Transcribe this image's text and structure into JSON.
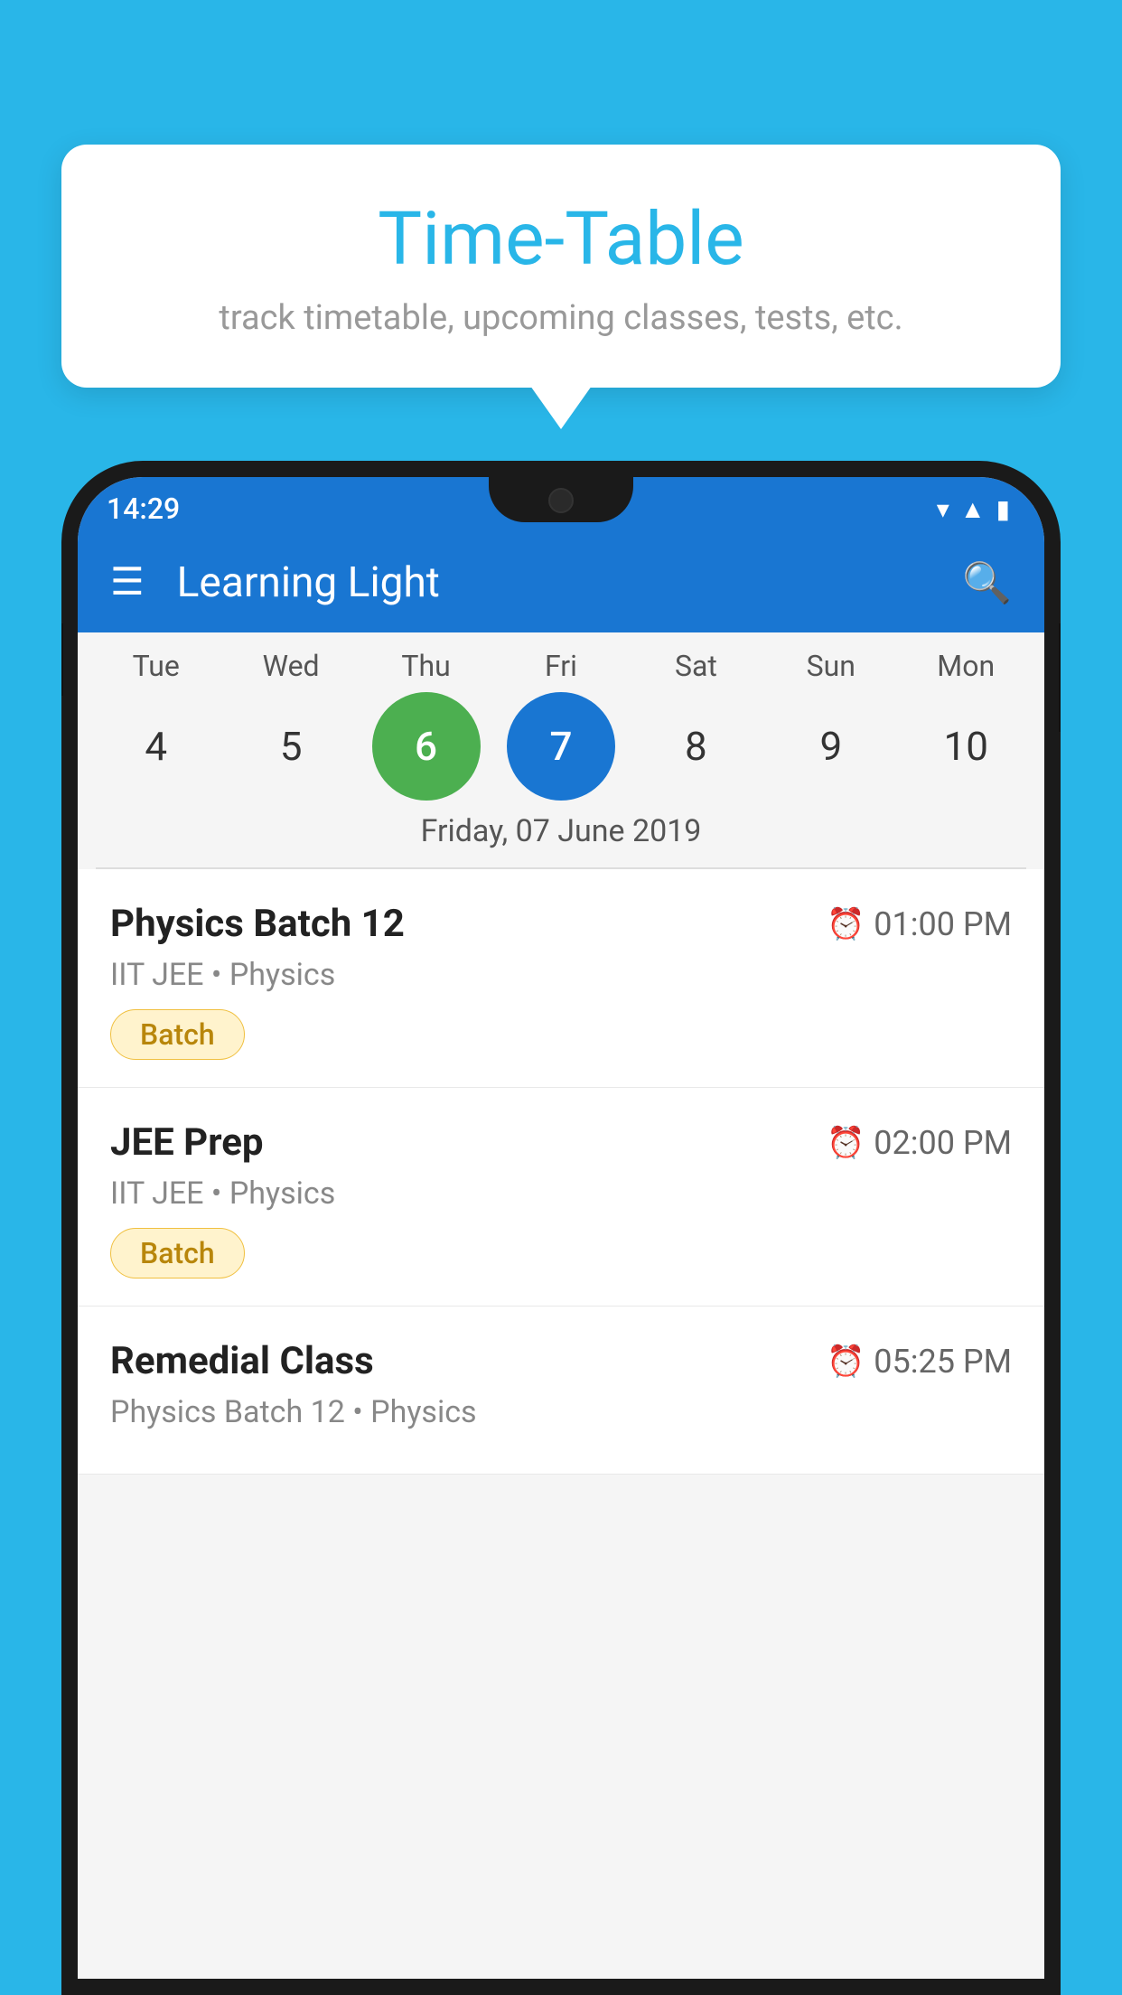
{
  "background_color": "#29b6e8",
  "tooltip": {
    "title": "Time-Table",
    "subtitle": "track timetable, upcoming classes, tests, etc."
  },
  "app": {
    "title": "Learning Light"
  },
  "status_bar": {
    "time": "14:29"
  },
  "calendar": {
    "days": [
      {
        "name": "Tue",
        "number": "4",
        "state": "normal"
      },
      {
        "name": "Wed",
        "number": "5",
        "state": "normal"
      },
      {
        "name": "Thu",
        "number": "6",
        "state": "today"
      },
      {
        "name": "Fri",
        "number": "7",
        "state": "selected"
      },
      {
        "name": "Sat",
        "number": "8",
        "state": "normal"
      },
      {
        "name": "Sun",
        "number": "9",
        "state": "normal"
      },
      {
        "name": "Mon",
        "number": "10",
        "state": "normal"
      }
    ],
    "selected_date_label": "Friday, 07 June 2019"
  },
  "schedule": {
    "items": [
      {
        "title": "Physics Batch 12",
        "time": "01:00 PM",
        "meta": "IIT JEE • Physics",
        "tag": "Batch"
      },
      {
        "title": "JEE Prep",
        "time": "02:00 PM",
        "meta": "IIT JEE • Physics",
        "tag": "Batch"
      },
      {
        "title": "Remedial Class",
        "time": "05:25 PM",
        "meta": "Physics Batch 12 • Physics",
        "tag": null
      }
    ]
  }
}
